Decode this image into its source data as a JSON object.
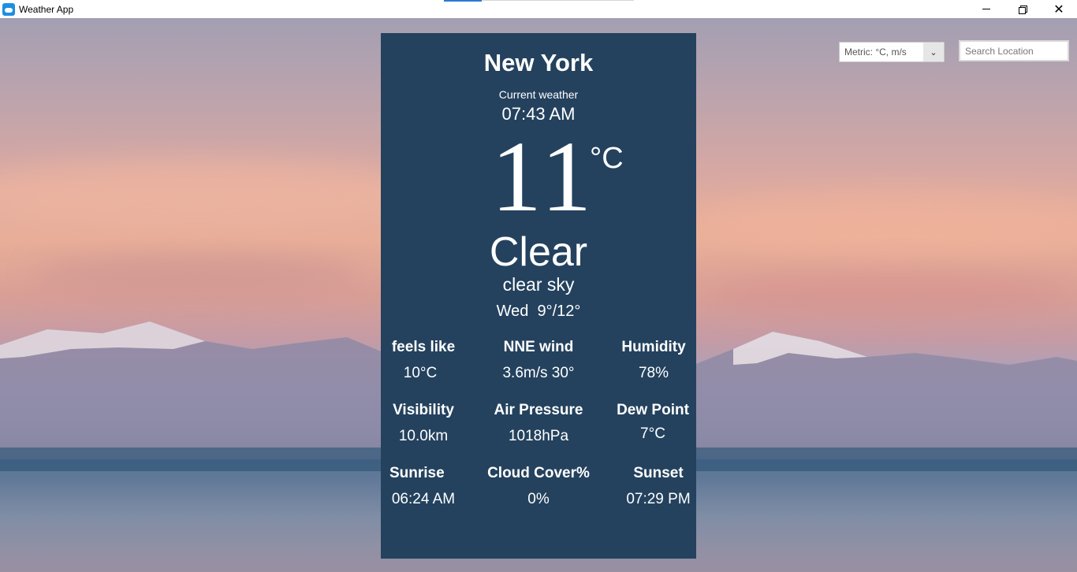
{
  "window": {
    "title": "Weather App",
    "controls": {
      "minimize": "minimize-icon",
      "restore": "restore-icon",
      "close": "close-icon"
    }
  },
  "controls": {
    "units_selected": "Metric: °C, m/s",
    "search_placeholder": "Search Location"
  },
  "weather": {
    "city": "New York",
    "current_label": "Current weather",
    "time": "07:43 AM",
    "temperature": "11",
    "temperature_unit": "°C",
    "condition": "Clear",
    "description": "clear sky",
    "day_range": "Wed  9°/12°"
  },
  "stats": [
    {
      "label": "feels like",
      "value": "10°C"
    },
    {
      "label": "NNE wind",
      "value": "3.6m/s 30°"
    },
    {
      "label": "Humidity",
      "value": "78%"
    },
    {
      "label": "Visibility",
      "value": "10.0km"
    },
    {
      "label": "Air Pressure",
      "value": "1018hPa"
    },
    {
      "label": "Dew Point",
      "value": "7°C"
    },
    {
      "label": "Sunrise",
      "value": "06:24 AM"
    },
    {
      "label": "Cloud Cover%",
      "value": "0%"
    },
    {
      "label": "Sunset",
      "value": "07:29 PM"
    }
  ],
  "colors": {
    "card_background": "#24425e",
    "text": "#ffffff"
  }
}
